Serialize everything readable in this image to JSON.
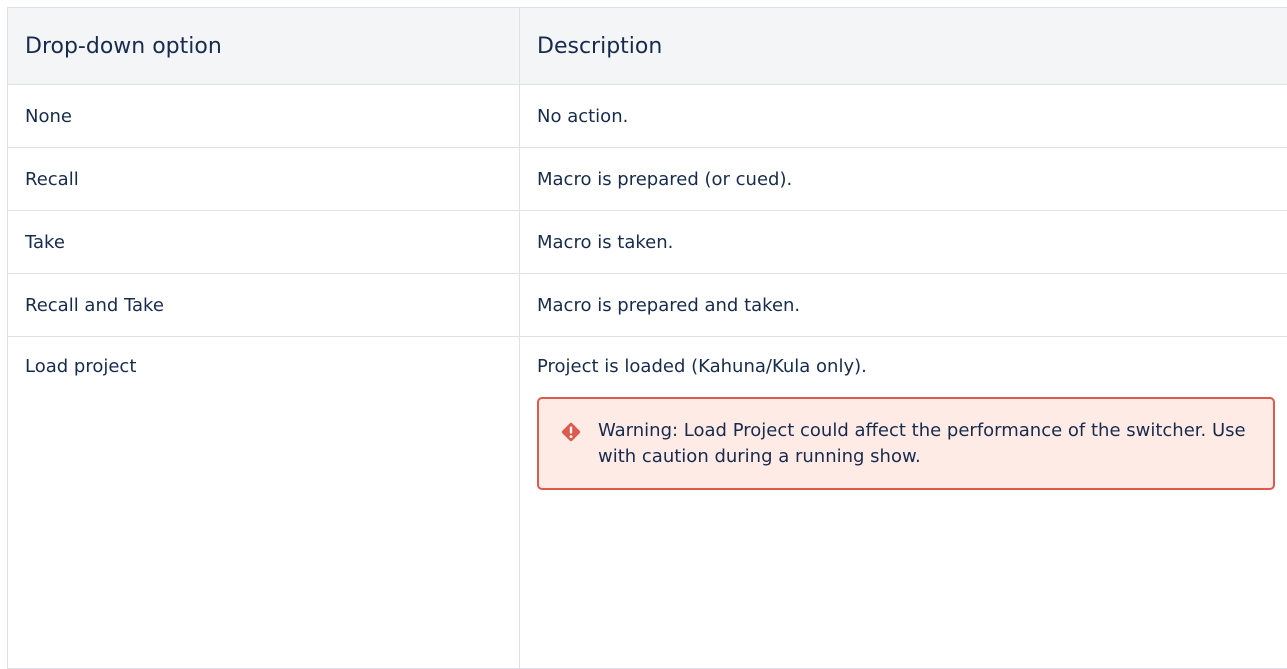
{
  "table": {
    "headers": [
      "Drop-down option",
      "Description"
    ],
    "rows": [
      {
        "option": "None",
        "description": "No action."
      },
      {
        "option": "Recall",
        "description": "Macro is prepared (or cued)."
      },
      {
        "option": "Take",
        "description": "Macro is taken."
      },
      {
        "option": "Recall and Take",
        "description": "Macro is prepared and taken."
      },
      {
        "option": "Load project",
        "description": "Project is loaded (Kahuna/Kula only)."
      }
    ]
  },
  "warning": {
    "label": "Warning: Load Project",
    "text": " could affect the performance of the switcher. Use with caution during a running show.",
    "icon": "warning-diamond-icon",
    "color": "#de5a4e"
  }
}
